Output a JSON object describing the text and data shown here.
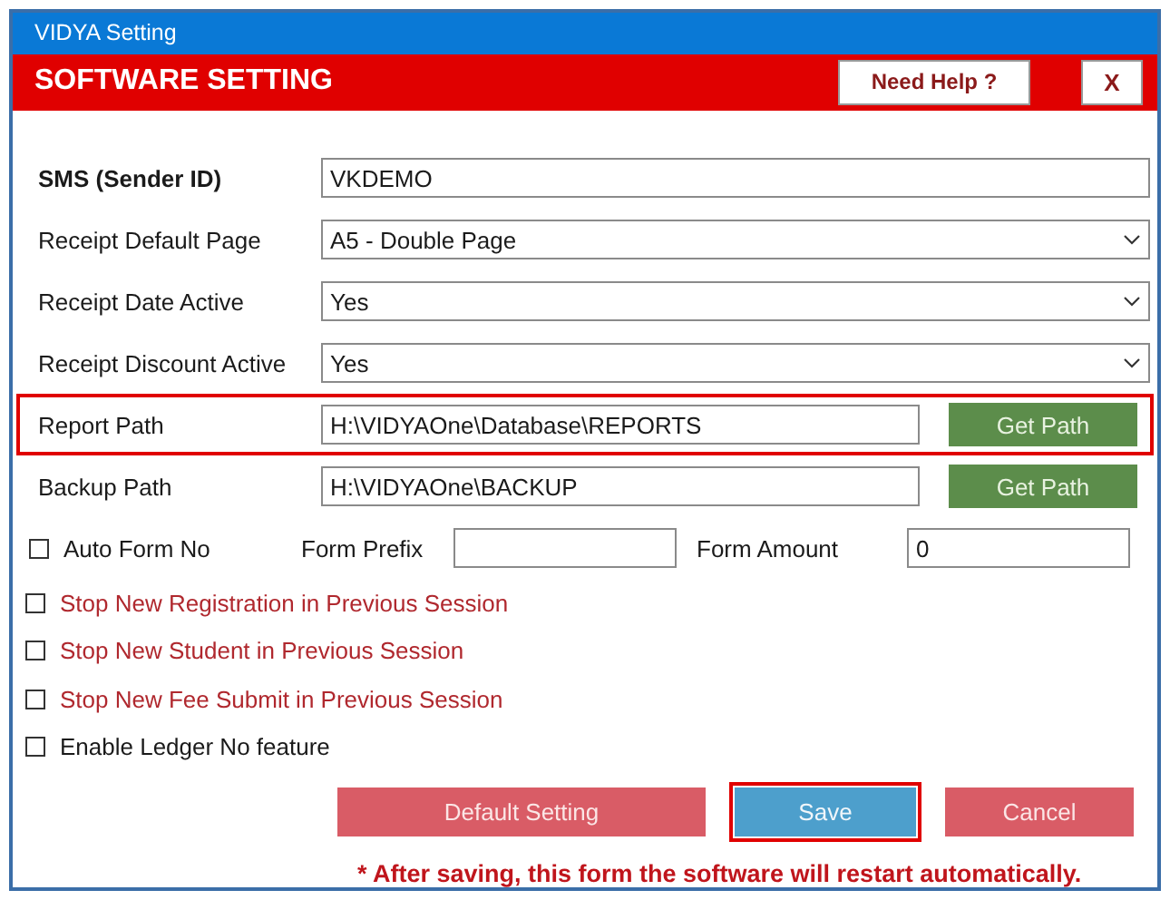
{
  "window": {
    "title": "VIDYA Setting"
  },
  "header": {
    "title": "SOFTWARE SETTING",
    "help_button": "Need Help ?",
    "close_button": "X"
  },
  "fields": [
    {
      "kind": "text",
      "label": "SMS (Sender ID)",
      "value": "VKDEMO",
      "highlighted": false
    },
    {
      "kind": "select",
      "label": "Receipt Default Page",
      "value": "A5 - Double Page",
      "highlighted": false
    },
    {
      "kind": "select",
      "label": "Receipt Date Active",
      "value": "Yes",
      "highlighted": false
    },
    {
      "kind": "select",
      "label": "Receipt Discount Active",
      "value": "Yes",
      "highlighted": false
    },
    {
      "kind": "path",
      "label": "Report Path",
      "value": "H:\\VIDYAOne\\Database\\REPORTS",
      "button": "Get Path",
      "highlighted": true
    },
    {
      "kind": "path",
      "label": "Backup Path",
      "value": "H:\\VIDYAOne\\BACKUP",
      "button": "Get Path",
      "highlighted": false
    }
  ],
  "auto_form": {
    "label": "Auto Form No",
    "checked": false,
    "prefix_label": "Form Prefix",
    "amount_label": "Form Amount",
    "amount_value": "0"
  },
  "options": [
    {
      "label": "Stop New Registration in Previous Session",
      "checked": false,
      "color": "#b0282e"
    },
    {
      "label": "Stop New Student in Previous Session",
      "checked": false,
      "color": "#b0282e"
    },
    {
      "label": "Stop New Fee Submit in Previous Session",
      "checked": false,
      "color": "#b0282e"
    },
    {
      "label": "Enable Ledger No feature",
      "checked": false,
      "color": "#1a1a1a"
    }
  ],
  "buttons": [
    {
      "kind": "reset",
      "label": "Default Setting",
      "highlighted": false
    },
    {
      "kind": "save",
      "label": "Save",
      "highlighted": true
    },
    {
      "kind": "cancel",
      "label": "Cancel",
      "highlighted": false
    }
  ],
  "note": "* After saving, this form the software will restart automatically."
}
